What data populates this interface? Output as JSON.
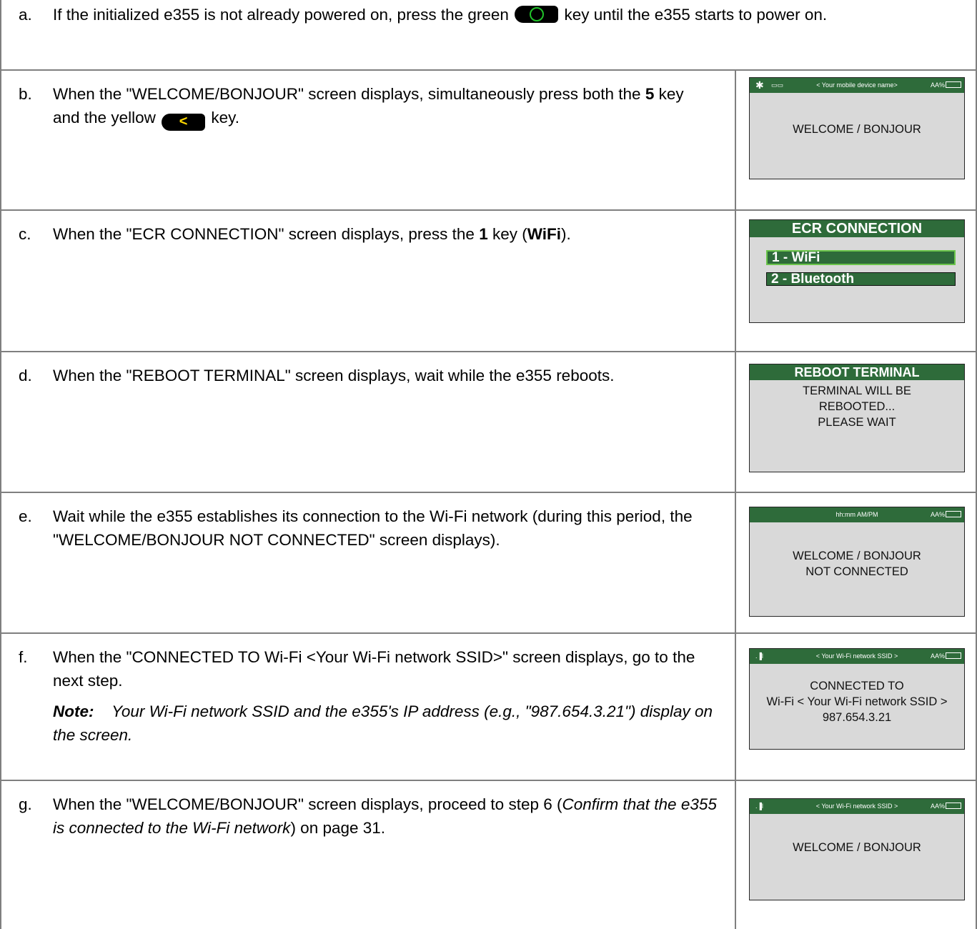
{
  "steps": [
    {
      "letter": "a.",
      "text_before": "If the initialized e355 is not already powered on, press the green",
      "key": "green-power-key",
      "text_after": "key until the e355 starts to power on."
    },
    {
      "letter": "b.",
      "text_1": "When the \"WELCOME/BONJOUR\" screen displays, simultaneously press both the",
      "bold_1": "5",
      "text_2": "key and the yellow",
      "key": "yellow-back-key",
      "key_glyph": "<",
      "text_3": "key.",
      "screen": {
        "status_left": "bluetooth",
        "status_center": "< Your mobile device name>",
        "status_right": "AA%",
        "lines": [
          "WELCOME / BONJOUR"
        ]
      }
    },
    {
      "letter": "c.",
      "text_1": "When the \"ECR CONNECTION\" screen displays, press the",
      "bold_1": "1",
      "text_2": "key (",
      "bold_2": "WiFi",
      "text_3": ").",
      "screen": {
        "title": "ECR CONNECTION",
        "options": [
          "1 - WiFi",
          "2 - Bluetooth"
        ]
      }
    },
    {
      "letter": "d.",
      "text": "When the \"REBOOT TERMINAL\" screen displays, wait while the e355 reboots.",
      "screen": {
        "title": "REBOOT TERMINAL",
        "lines": [
          "TERMINAL WILL BE",
          "REBOOTED...",
          "PLEASE WAIT"
        ]
      }
    },
    {
      "letter": "e.",
      "text": "Wait while the e355 establishes its connection to the Wi-Fi network (during this period, the \"WELCOME/BONJOUR NOT CONNECTED\" screen displays).",
      "screen": {
        "status_center": "hh:mm AM/PM",
        "status_right": "AA%",
        "lines": [
          "WELCOME / BONJOUR",
          "NOT CONNECTED"
        ]
      }
    },
    {
      "letter": "f.",
      "text": "When the \"CONNECTED TO Wi-Fi <Your Wi-Fi network SSID>\" screen displays, go to the next step.",
      "note_label": "Note:",
      "note_text": "Your Wi-Fi network SSID and the e355's IP address (e.g., \"987.654.3.21\") display on the screen.",
      "screen": {
        "status_left": ".∥l",
        "status_center": "< Your Wi-Fi network SSID >",
        "status_right": "AA%",
        "lines": [
          "CONNECTED TO",
          "Wi-Fi < Your Wi-Fi network SSID >",
          "987.654.3.21"
        ]
      }
    },
    {
      "letter": "g.",
      "text_1": "When the \"WELCOME/BONJOUR\" screen displays, proceed to step 6 (",
      "italic_1": "Confirm that the e355 is connected to the Wi-Fi network",
      "text_2": ") on page 31.",
      "screen": {
        "status_left": ".∥l",
        "status_center": "< Your Wi-Fi network SSID >",
        "status_right": "AA%",
        "lines": [
          "WELCOME / BONJOUR"
        ]
      }
    }
  ],
  "colors": {
    "screen_header": "#2e6b3a",
    "screen_bg": "#d9d9d9",
    "green_key_ring": "#21c22a",
    "yellow_key_glyph": "#ffd800",
    "border": "#7f7f7f"
  }
}
